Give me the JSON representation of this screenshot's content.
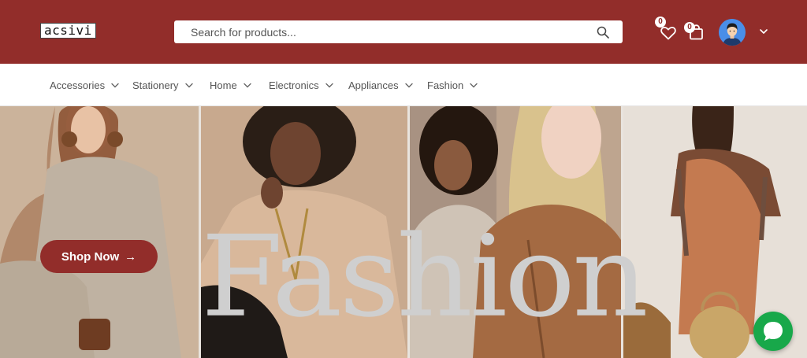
{
  "header": {
    "logo_text": "acsivi",
    "background": "#922d2a",
    "search": {
      "placeholder": "Search for products..."
    },
    "wishlist_count": "0",
    "cart_count": "0"
  },
  "nav": {
    "items": [
      {
        "label": "Accessories"
      },
      {
        "label": "Stationery"
      },
      {
        "label": "Home"
      },
      {
        "label": "Electronics"
      },
      {
        "label": "Appliances"
      },
      {
        "label": "Fashion"
      }
    ]
  },
  "hero": {
    "headline": "Fashion",
    "cta_label": "Shop Now",
    "cta_arrow": "→",
    "accent": "#922d2a"
  },
  "chat": {
    "color": "#18a84a",
    "icon": "chat-bubble-icon"
  }
}
